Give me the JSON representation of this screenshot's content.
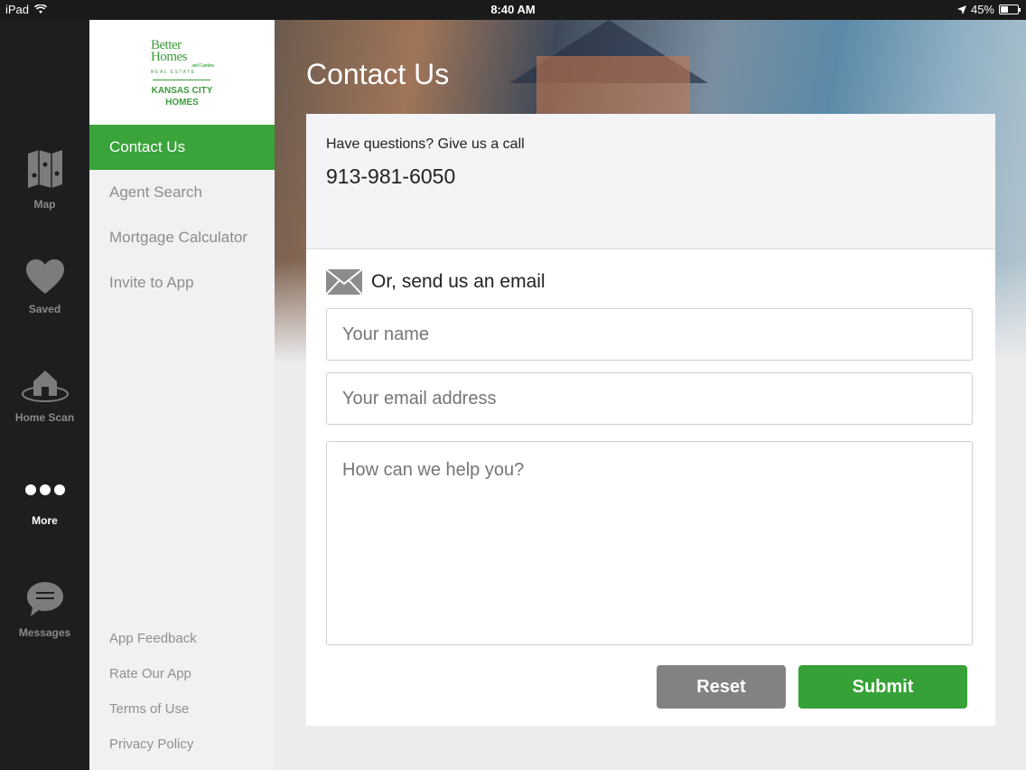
{
  "status_bar": {
    "device": "iPad",
    "time": "8:40 AM",
    "battery": "45%",
    "battery_level": 0.45
  },
  "tabbar": {
    "items": [
      {
        "label": "Map",
        "icon": "map-icon"
      },
      {
        "label": "Saved",
        "icon": "heart-icon"
      },
      {
        "label": "Home Scan",
        "icon": "home-scan-icon"
      },
      {
        "label": "More",
        "icon": "more-dots-icon",
        "active": true
      },
      {
        "label": "Messages",
        "icon": "chat-bubble-icon"
      }
    ]
  },
  "logo": {
    "brand_line1": "Better",
    "brand_line2": "Homes",
    "brand_line3": "and Gardens",
    "brand_line4": "REAL ESTATE",
    "sub_line1": "KANSAS CITY",
    "sub_line2": "HOMES"
  },
  "sidemenu": {
    "items": [
      {
        "label": "Contact Us",
        "active": true
      },
      {
        "label": "Agent Search"
      },
      {
        "label": "Mortgage Calculator"
      },
      {
        "label": "Invite to App"
      }
    ],
    "footer": [
      "App Feedback",
      "Rate Our App",
      "Terms of Use",
      "Privacy Policy"
    ]
  },
  "main": {
    "title": "Contact Us",
    "call_prompt": "Have questions? Give us a call",
    "phone": "913-981-6050",
    "email_prompt": "Or, send us an email",
    "name_placeholder": "Your name",
    "email_placeholder": "Your email address",
    "message_placeholder": "How can we help you?",
    "reset_label": "Reset",
    "submit_label": "Submit"
  },
  "colors": {
    "accent": "#3aa43a",
    "reset": "#828285",
    "tabbar": "#1e1e20"
  }
}
